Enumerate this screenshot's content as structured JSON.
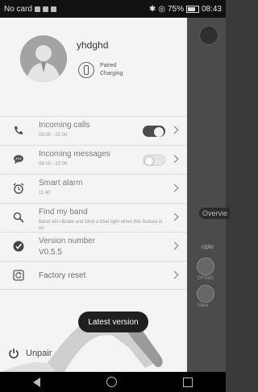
{
  "status_bar": {
    "carrier": "No card",
    "battery": "75%",
    "time": "08:43"
  },
  "profile": {
    "username": "yhdghd",
    "band_status_line1": "Paired",
    "band_status_line2": "Charging"
  },
  "menu": {
    "incoming_calls": {
      "title": "Incoming calls",
      "sub": "08:00 - 22:00",
      "enabled": true
    },
    "incoming_messages": {
      "title": "Incoming messages",
      "sub": "08:00 - 22:00",
      "enabled": false
    },
    "smart_alarm": {
      "title": "Smart alarm",
      "sub": "11:40"
    },
    "find_band": {
      "title": "Find my band",
      "sub": "Band will vibrate and blink a blue light when this feature is on"
    },
    "version": {
      "title": "Version number",
      "value": "V0.5.5"
    },
    "factory_reset": {
      "title": "Factory reset"
    }
  },
  "unpair": {
    "label": "Unpair"
  },
  "toast": {
    "text": "Latest version"
  },
  "background": {
    "overview_label": "Overvie",
    "people_label": "ople",
    "avatar1_label": "DFS3D",
    "avatar2_label": "Mam"
  },
  "icons": {
    "phone": "phone-icon",
    "message": "message-icon",
    "alarm": "alarm-clock-icon",
    "search": "search-icon",
    "version": "check-badge-icon",
    "reset": "reset-icon",
    "power": "power-icon"
  }
}
